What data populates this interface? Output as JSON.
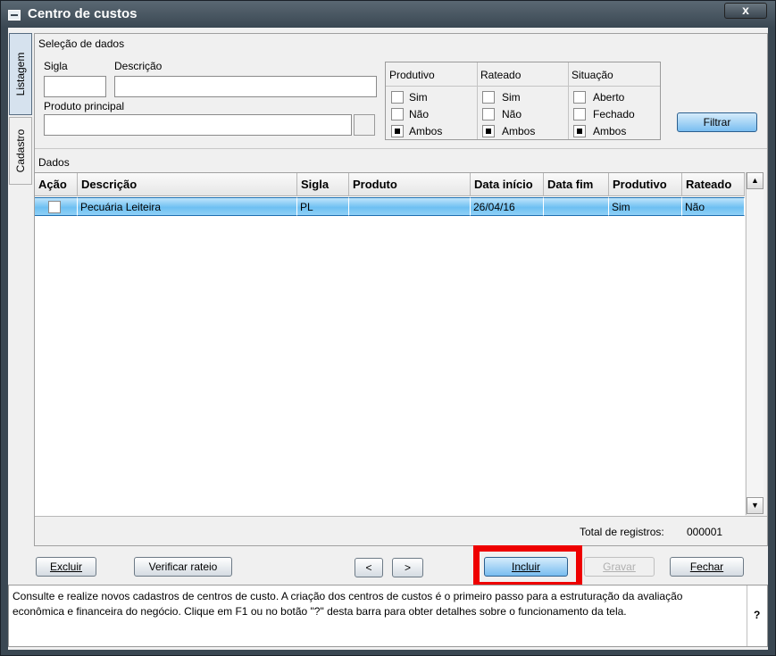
{
  "window": {
    "title": "Centro de custos",
    "close_label": "x"
  },
  "side_tabs": {
    "listagem": "Listagem",
    "cadastro": "Cadastro"
  },
  "selection": {
    "heading": "Seleção de dados",
    "sigla_label": "Sigla",
    "sigla_value": "",
    "descricao_label": "Descrição",
    "descricao_value": "",
    "produto_label": "Produto principal",
    "produto_value": "",
    "filter_button": "Filtrar",
    "groups": {
      "produtivo": {
        "title": "Produtivo",
        "options": [
          "Sim",
          "Não",
          "Ambos"
        ],
        "checked": 2
      },
      "rateado": {
        "title": "Rateado",
        "options": [
          "Sim",
          "Não",
          "Ambos"
        ],
        "checked": 2
      },
      "situacao": {
        "title": "Situação",
        "options": [
          "Aberto",
          "Fechado",
          "Ambos"
        ],
        "checked": 2
      }
    }
  },
  "data_section": {
    "heading": "Dados",
    "columns": [
      "Ação",
      "Descrição",
      "Sigla",
      "Produto",
      "Data início",
      "Data fim",
      "Produtivo",
      "Rateado"
    ],
    "rows": [
      {
        "descricao": "Pecuária Leiteira",
        "sigla": "PL",
        "produto": "",
        "data_inicio": "26/04/16",
        "data_fim": "",
        "produtivo": "Sim",
        "rateado": "Não"
      }
    ],
    "total_label": "Total de registros:",
    "total_value": "000001"
  },
  "buttons": {
    "excluir": "Excluir",
    "verificar": "Verificar rateio",
    "prev": "<",
    "next": ">",
    "incluir": "Incluir",
    "gravar": "Gravar",
    "fechar": "Fechar"
  },
  "status": {
    "text": "Consulte e realize novos cadastros de centros de custo. A criação dos centros de custos é o primeiro passo para a estruturação da avaliação econômica e financeira do negócio. Clique em F1 ou no botão \"?\" desta barra para obter detalhes sobre o funcionamento da tela.",
    "help": "?"
  },
  "colors": {
    "titlebar": "#3a4752",
    "row_highlight": "#6ec0f2",
    "annotation": "#ee0000"
  }
}
